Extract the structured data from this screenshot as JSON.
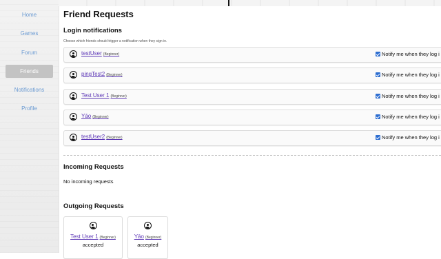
{
  "sidebar": {
    "items": [
      {
        "label": "Home",
        "active": false
      },
      {
        "label": "Games",
        "active": false
      },
      {
        "label": "Forum",
        "active": false
      },
      {
        "label": "Friends",
        "active": true
      },
      {
        "label": "Notifications",
        "active": false
      },
      {
        "label": "Profile",
        "active": false
      }
    ]
  },
  "page": {
    "title": "Friend Requests"
  },
  "login_notifications": {
    "heading": "Login notifications",
    "hint": "Choose which friends should trigger a notification when they sign in.",
    "notify_label": "Notify me when they log i",
    "friends": [
      {
        "name": "testUser",
        "level": "(Beginner)",
        "notify": true
      },
      {
        "name": "pingTest2",
        "level": "(Beginner)",
        "notify": true
      },
      {
        "name": "Test User 1",
        "level": "(Beginner)",
        "notify": true
      },
      {
        "name": "Yāo",
        "level": "(Beginner)",
        "notify": true
      },
      {
        "name": "testUser2",
        "level": "(Beginner)",
        "notify": true
      }
    ]
  },
  "incoming": {
    "heading": "Incoming Requests",
    "empty_text": "No incoming requests"
  },
  "outgoing": {
    "heading": "Outgoing Requests",
    "requests": [
      {
        "name": "Test User 1",
        "level": "(Beginner)",
        "status": "accepted"
      },
      {
        "name": "Yāo",
        "level": "(Beginner)",
        "status": "accepted"
      }
    ]
  },
  "colors": {
    "link": "#5b35b5",
    "nav": "#6b9bd3",
    "nav_active_bg": "#c3c3c3",
    "checkbox": "#2f6fd1"
  },
  "icons": {
    "avatar": "user-circle-icon",
    "checkbox": "checkbox-checked-icon"
  }
}
